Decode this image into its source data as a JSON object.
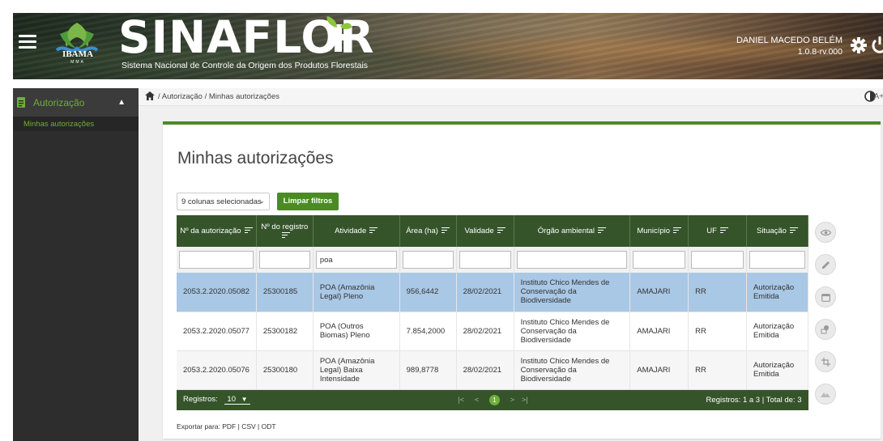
{
  "header": {
    "brand": "SINAFLOR",
    "subtitle": "Sistema Nacional de Controle da Origem dos Produtos Florestais",
    "ibama": "IBAMA",
    "ibama_sub": "MMA",
    "user_name": "DANIEL MACEDO BELÉM",
    "version": "1.0.8-rv.000"
  },
  "sidebar": {
    "section": "Autorização",
    "items": [
      {
        "label": "Minhas autorizações"
      }
    ]
  },
  "breadcrumb": {
    "items": [
      "Autorização",
      "Minhas autorizações"
    ],
    "font_control": "A+ A"
  },
  "main": {
    "title": "Minhas autorizações",
    "columns_select": "9 colunas selecionadas",
    "clear_filters": "Limpar filtros",
    "columns": [
      "Nº da autorização",
      "Nº do registro",
      "Atividade",
      "Área (ha)",
      "Validade",
      "Órgão ambiental",
      "Município",
      "UF",
      "Situação"
    ],
    "filter_activity_value": "poa",
    "rows": [
      {
        "autorizacao": "2053.2.2020.05082",
        "registro": "25300185",
        "atividade": "POA (Amazônia Legal) Pleno",
        "area": "956,6442",
        "validade": "28/02/2021",
        "orgao": "Instituto Chico Mendes de Conservação da Biodiversidade",
        "municipio": "AMAJARI",
        "uf": "RR",
        "situacao": "Autorização Emitida"
      },
      {
        "autorizacao": "2053.2.2020.05077",
        "registro": "25300182",
        "atividade": "POA (Outros Biomas) Pleno",
        "area": "7.854,2000",
        "validade": "28/02/2021",
        "orgao": "Instituto Chico Mendes de Conservação da Biodiversidade",
        "municipio": "AMAJARI",
        "uf": "RR",
        "situacao": "Autorização Emitida"
      },
      {
        "autorizacao": "2053.2.2020.05076",
        "registro": "25300180",
        "atividade": "POA (Amazônia Legal) Baixa Intensidade",
        "area": "989,8778",
        "validade": "28/02/2021",
        "orgao": "Instituto Chico Mendes de Conservação da Biodiversidade",
        "municipio": "AMAJARI",
        "uf": "RR",
        "situacao": "Autorização Emitida"
      }
    ],
    "footer": {
      "records_label": "Registros:",
      "page_size": "10",
      "current_page": "1",
      "summary": "Registros: 1 a 3 | Total de: 3"
    },
    "export": {
      "label": "Exportar para:",
      "pdf": "PDF",
      "csv": "CSV",
      "odt": "ODT"
    }
  },
  "colors": {
    "accent": "#4b8b24",
    "table_header": "#35542a",
    "selected_row": "#a9c8e6",
    "sidebar_bg": "#2d2d2d",
    "sidebar_text": "#6fae3b"
  }
}
